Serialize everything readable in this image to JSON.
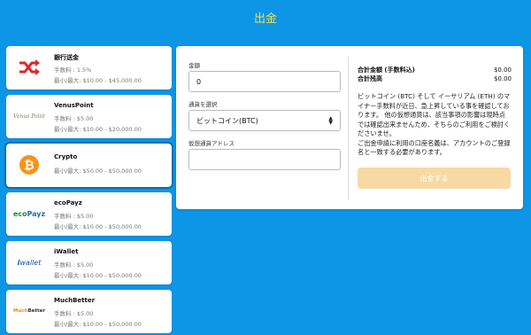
{
  "page": {
    "title": "出金"
  },
  "methods": [
    {
      "name": "銀行送金",
      "fee": "手数料 : 1.5%",
      "limit": "最小/最大: $10.00 - $45,000.00",
      "icon": "shuffle-icon",
      "icon_color": "#e0252a"
    },
    {
      "name": "VenusPoint",
      "fee": "手数料 : $5.00",
      "limit": "最小/最大: $10.00 - $20,000.00",
      "logo_text": "Venus Point",
      "icon": "venuspoint-logo"
    },
    {
      "name": "Crypto",
      "limit": "最小/最大: $50.00 - $50,000.00",
      "icon": "bitcoin-icon",
      "icon_color": "#f7931a"
    },
    {
      "name": "ecoPayz",
      "fee": "手数料 : $5.00",
      "limit": "最小/最大: $10.00 - $50,000.00",
      "logo_text_a": "eco",
      "logo_text_b": "Payz",
      "icon": "ecopayz-logo"
    },
    {
      "name": "iWallet",
      "fee": "手数料 : $5.00",
      "limit": "最小/最大: $10.00 - $50,000.00",
      "logo_text_a": "i",
      "logo_text_b": "wallet",
      "icon": "iwallet-logo"
    },
    {
      "name": "MuchBetter",
      "fee": "手数料 : $5.00",
      "limit": "最小/最大: $10.00 - $50,000.00",
      "logo_text_a": "Much",
      "logo_text_b": "Better",
      "icon": "muchbetter-logo"
    }
  ],
  "form": {
    "amount_label": "金額",
    "amount_value": "0",
    "currency_label": "通貨を選択",
    "currency_value": "ビットコイン(BTC)",
    "address_label": "仮想通貨アドレス",
    "address_value": ""
  },
  "summary": {
    "total_label": "合計金額 (手数料込)",
    "total_value": "$0.00",
    "balance_label": "合計残高",
    "balance_value": "$0.00",
    "note_1": "ビットコイン (BTC) そして イーサリアム (ETH) のマイナー手数料が近日、急上昇している事を確認しております。 他の仮想通貨は、該当事項の影響は現時点では確認出来ませんため、そちらのご利用をご検討くださいませ。",
    "note_2": "ご出金申請に利用の口座名義は、アカウントのご登録名と一致する必要があります。"
  },
  "submit": {
    "label": "出金する"
  },
  "colors": {
    "background": "#0d96e6",
    "title": "#f4e04a",
    "button": "#f8d9a3"
  }
}
